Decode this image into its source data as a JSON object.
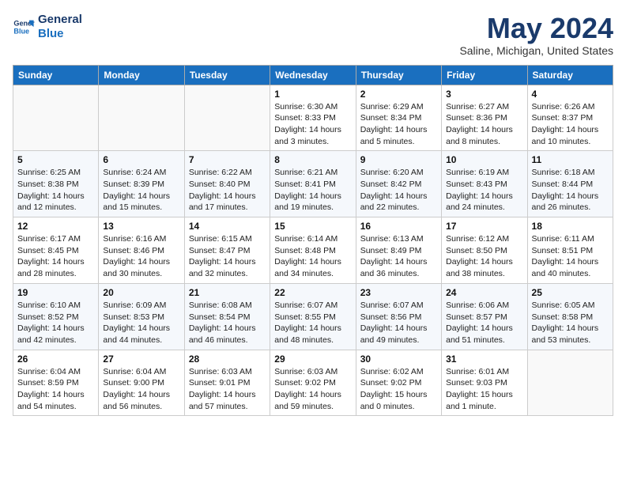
{
  "logo": {
    "text_line1": "General",
    "text_line2": "Blue"
  },
  "title": "May 2024",
  "location": "Saline, Michigan, United States",
  "days_of_week": [
    "Sunday",
    "Monday",
    "Tuesday",
    "Wednesday",
    "Thursday",
    "Friday",
    "Saturday"
  ],
  "weeks": [
    [
      {
        "day": "",
        "info": ""
      },
      {
        "day": "",
        "info": ""
      },
      {
        "day": "",
        "info": ""
      },
      {
        "day": "1",
        "info": "Sunrise: 6:30 AM\nSunset: 8:33 PM\nDaylight: 14 hours\nand 3 minutes."
      },
      {
        "day": "2",
        "info": "Sunrise: 6:29 AM\nSunset: 8:34 PM\nDaylight: 14 hours\nand 5 minutes."
      },
      {
        "day": "3",
        "info": "Sunrise: 6:27 AM\nSunset: 8:36 PM\nDaylight: 14 hours\nand 8 minutes."
      },
      {
        "day": "4",
        "info": "Sunrise: 6:26 AM\nSunset: 8:37 PM\nDaylight: 14 hours\nand 10 minutes."
      }
    ],
    [
      {
        "day": "5",
        "info": "Sunrise: 6:25 AM\nSunset: 8:38 PM\nDaylight: 14 hours\nand 12 minutes."
      },
      {
        "day": "6",
        "info": "Sunrise: 6:24 AM\nSunset: 8:39 PM\nDaylight: 14 hours\nand 15 minutes."
      },
      {
        "day": "7",
        "info": "Sunrise: 6:22 AM\nSunset: 8:40 PM\nDaylight: 14 hours\nand 17 minutes."
      },
      {
        "day": "8",
        "info": "Sunrise: 6:21 AM\nSunset: 8:41 PM\nDaylight: 14 hours\nand 19 minutes."
      },
      {
        "day": "9",
        "info": "Sunrise: 6:20 AM\nSunset: 8:42 PM\nDaylight: 14 hours\nand 22 minutes."
      },
      {
        "day": "10",
        "info": "Sunrise: 6:19 AM\nSunset: 8:43 PM\nDaylight: 14 hours\nand 24 minutes."
      },
      {
        "day": "11",
        "info": "Sunrise: 6:18 AM\nSunset: 8:44 PM\nDaylight: 14 hours\nand 26 minutes."
      }
    ],
    [
      {
        "day": "12",
        "info": "Sunrise: 6:17 AM\nSunset: 8:45 PM\nDaylight: 14 hours\nand 28 minutes."
      },
      {
        "day": "13",
        "info": "Sunrise: 6:16 AM\nSunset: 8:46 PM\nDaylight: 14 hours\nand 30 minutes."
      },
      {
        "day": "14",
        "info": "Sunrise: 6:15 AM\nSunset: 8:47 PM\nDaylight: 14 hours\nand 32 minutes."
      },
      {
        "day": "15",
        "info": "Sunrise: 6:14 AM\nSunset: 8:48 PM\nDaylight: 14 hours\nand 34 minutes."
      },
      {
        "day": "16",
        "info": "Sunrise: 6:13 AM\nSunset: 8:49 PM\nDaylight: 14 hours\nand 36 minutes."
      },
      {
        "day": "17",
        "info": "Sunrise: 6:12 AM\nSunset: 8:50 PM\nDaylight: 14 hours\nand 38 minutes."
      },
      {
        "day": "18",
        "info": "Sunrise: 6:11 AM\nSunset: 8:51 PM\nDaylight: 14 hours\nand 40 minutes."
      }
    ],
    [
      {
        "day": "19",
        "info": "Sunrise: 6:10 AM\nSunset: 8:52 PM\nDaylight: 14 hours\nand 42 minutes."
      },
      {
        "day": "20",
        "info": "Sunrise: 6:09 AM\nSunset: 8:53 PM\nDaylight: 14 hours\nand 44 minutes."
      },
      {
        "day": "21",
        "info": "Sunrise: 6:08 AM\nSunset: 8:54 PM\nDaylight: 14 hours\nand 46 minutes."
      },
      {
        "day": "22",
        "info": "Sunrise: 6:07 AM\nSunset: 8:55 PM\nDaylight: 14 hours\nand 48 minutes."
      },
      {
        "day": "23",
        "info": "Sunrise: 6:07 AM\nSunset: 8:56 PM\nDaylight: 14 hours\nand 49 minutes."
      },
      {
        "day": "24",
        "info": "Sunrise: 6:06 AM\nSunset: 8:57 PM\nDaylight: 14 hours\nand 51 minutes."
      },
      {
        "day": "25",
        "info": "Sunrise: 6:05 AM\nSunset: 8:58 PM\nDaylight: 14 hours\nand 53 minutes."
      }
    ],
    [
      {
        "day": "26",
        "info": "Sunrise: 6:04 AM\nSunset: 8:59 PM\nDaylight: 14 hours\nand 54 minutes."
      },
      {
        "day": "27",
        "info": "Sunrise: 6:04 AM\nSunset: 9:00 PM\nDaylight: 14 hours\nand 56 minutes."
      },
      {
        "day": "28",
        "info": "Sunrise: 6:03 AM\nSunset: 9:01 PM\nDaylight: 14 hours\nand 57 minutes."
      },
      {
        "day": "29",
        "info": "Sunrise: 6:03 AM\nSunset: 9:02 PM\nDaylight: 14 hours\nand 59 minutes."
      },
      {
        "day": "30",
        "info": "Sunrise: 6:02 AM\nSunset: 9:02 PM\nDaylight: 15 hours\nand 0 minutes."
      },
      {
        "day": "31",
        "info": "Sunrise: 6:01 AM\nSunset: 9:03 PM\nDaylight: 15 hours\nand 1 minute."
      },
      {
        "day": "",
        "info": ""
      }
    ]
  ]
}
